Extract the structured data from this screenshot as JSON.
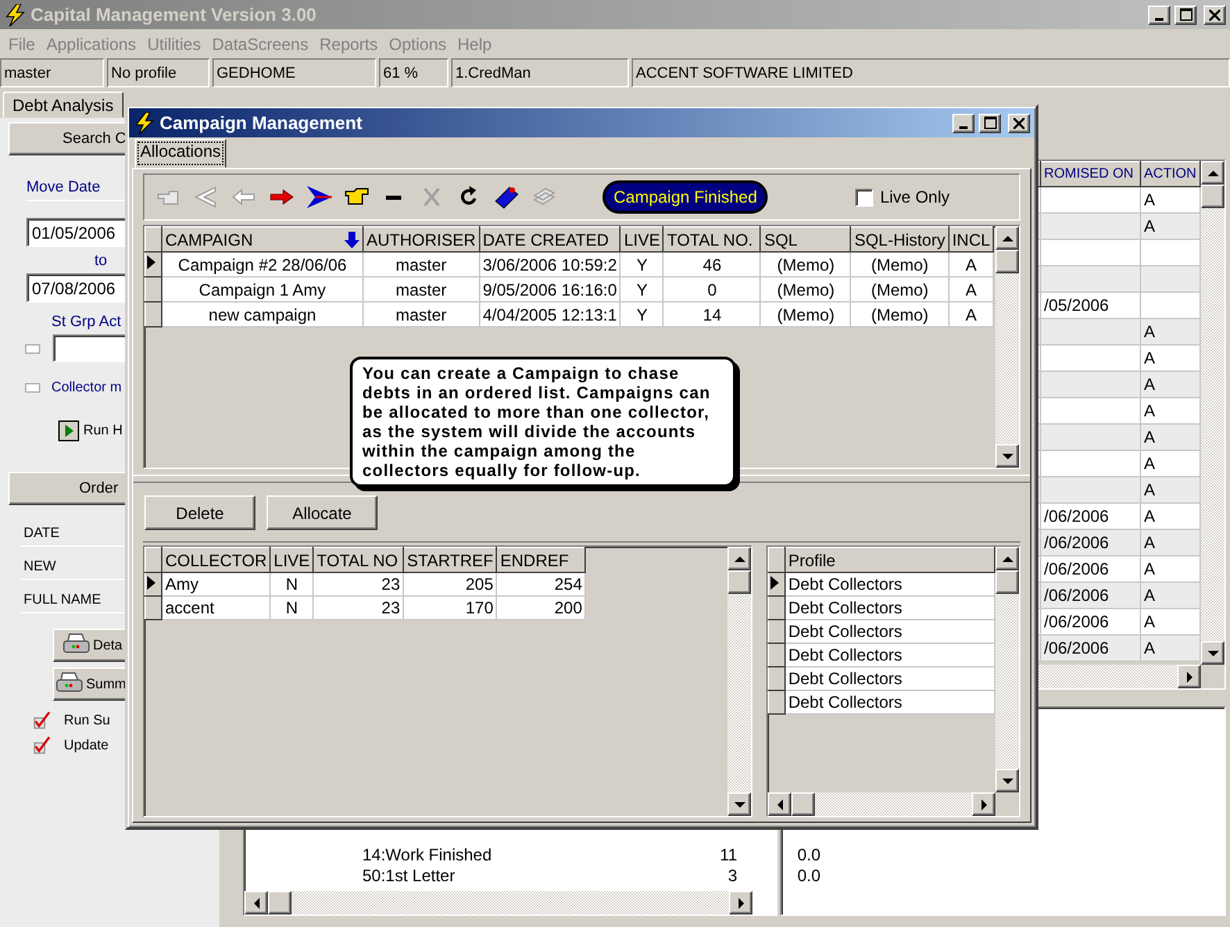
{
  "window": {
    "title": "Capital Management Version 3.00"
  },
  "menu": [
    "File",
    "Applications",
    "Utilities",
    "DataScreens",
    "Reports",
    "Options",
    "Help"
  ],
  "status_cells": [
    "master",
    "No profile",
    "GEDHOME",
    "61 %",
    "1.CredMan",
    "ACCENT SOFTWARE LIMITED"
  ],
  "tabs": [
    {
      "label": "Debt Analysis",
      "selected": false
    }
  ],
  "left_panel": {
    "search_button": "Search C",
    "move_date_label": "Move Date",
    "date_from": "01/05/2006",
    "to_label": "to",
    "date_to": "07/08/2006",
    "st_grp_label": "St Grp Act",
    "st_grp_checked": false,
    "collector_label": "Collector m",
    "collector_checked": false,
    "run_button": "Run H",
    "order_button": "Order",
    "fields": [
      "DATE",
      "NEW",
      "FULL NAME"
    ],
    "print_buttons": [
      "Deta",
      "Summ"
    ],
    "checks": [
      {
        "label": "Run Su",
        "checked": true
      },
      {
        "label": "Update",
        "checked": true
      }
    ]
  },
  "right_grid": {
    "columns": [
      "ROMISED ON",
      "ACTION"
    ],
    "rows": [
      {
        "action": "A"
      },
      {
        "action": "A"
      },
      {},
      {},
      {
        "promised_on": "/05/2006"
      },
      {
        "action": "A"
      },
      {
        "action": "A"
      },
      {
        "action": "A"
      },
      {
        "action": "A"
      },
      {
        "action": "A"
      },
      {
        "action": "A"
      },
      {
        "action": "A"
      },
      {
        "promised_on": "/06/2006",
        "action": "A"
      },
      {
        "promised_on": "/06/2006",
        "action": "A"
      },
      {
        "promised_on": "/06/2006",
        "action": "A"
      },
      {
        "promised_on": "/06/2006",
        "action": "A"
      },
      {
        "promised_on": "/06/2006",
        "action": "A"
      },
      {
        "promised_on": "/06/2006",
        "action": "A"
      }
    ]
  },
  "status_list": {
    "rows": [
      {
        "name": "14:Work Finished",
        "count": "11",
        "amount": "0.0"
      },
      {
        "name": "50:1st Letter",
        "count": "3",
        "amount": "0.0"
      }
    ]
  },
  "dialog": {
    "title": "Campaign Management",
    "tabs": [
      {
        "label": "Allocations",
        "selected": true
      }
    ],
    "toolbar": [
      {
        "kind": "hand-left",
        "disabled": true
      },
      {
        "kind": "arrow-double-left",
        "disabled": true
      },
      {
        "kind": "arrow-left",
        "disabled": true
      },
      {
        "kind": "arrow-right",
        "disabled": false
      },
      {
        "kind": "arrow-last",
        "disabled": false
      },
      {
        "kind": "hand-right",
        "disabled": false
      },
      {
        "kind": "minus",
        "disabled": false
      },
      {
        "kind": "cross",
        "disabled": true
      },
      {
        "kind": "refresh",
        "disabled": false
      },
      {
        "kind": "tag",
        "disabled": false
      },
      {
        "kind": "stack",
        "disabled": true
      }
    ],
    "status_pill": "Campaign Finished",
    "live_only": {
      "label": "Live Only",
      "checked": false
    },
    "campaigns": {
      "columns": [
        "CAMPAIGN",
        "AUTHORISER",
        "DATE CREATED",
        "LIVE",
        "TOTAL NO.",
        "SQL",
        "SQL-History",
        "INCL"
      ],
      "rows": [
        {
          "selected": true,
          "cells": [
            "Campaign #2  28/06/06",
            "master",
            "3/06/2006 10:59:2",
            "Y",
            "46",
            "(Memo)",
            "(Memo)",
            "A"
          ]
        },
        {
          "selected": false,
          "cells": [
            "Campaign 1 Amy",
            "master",
            "9/05/2006 16:16:0",
            "Y",
            "0",
            "(Memo)",
            "(Memo)",
            "A"
          ]
        },
        {
          "selected": false,
          "cells": [
            "new campaign",
            "master",
            "4/04/2005 12:13:1",
            "Y",
            "14",
            "(Memo)",
            "(Memo)",
            "A"
          ]
        }
      ]
    },
    "callout": "You can create a Campaign to chase debts in an ordered list. Campaigns can be allocated to more than one collector, as the system will divide the accounts within the campaign among the collectors equally for follow-up.",
    "buttons": [
      "Delete",
      "Allocate"
    ],
    "collectors": {
      "columns": [
        "COLLECTOR",
        "LIVE",
        "TOTAL NO",
        "STARTREF",
        "ENDREF"
      ],
      "rows": [
        {
          "selected": true,
          "cells": [
            "Amy",
            "N",
            "23",
            "205",
            "254"
          ]
        },
        {
          "selected": false,
          "cells": [
            "accent",
            "N",
            "23",
            "170",
            "200"
          ]
        }
      ]
    },
    "profiles": {
      "column": "Profile",
      "rows": [
        {
          "selected": true,
          "name": "Debt Collectors"
        },
        {
          "selected": false,
          "name": "Debt Collectors"
        },
        {
          "selected": false,
          "name": "Debt Collectors"
        },
        {
          "selected": false,
          "name": "Debt Collectors"
        },
        {
          "selected": false,
          "name": "Debt Collectors"
        },
        {
          "selected": false,
          "name": "Debt Collectors"
        }
      ]
    }
  }
}
